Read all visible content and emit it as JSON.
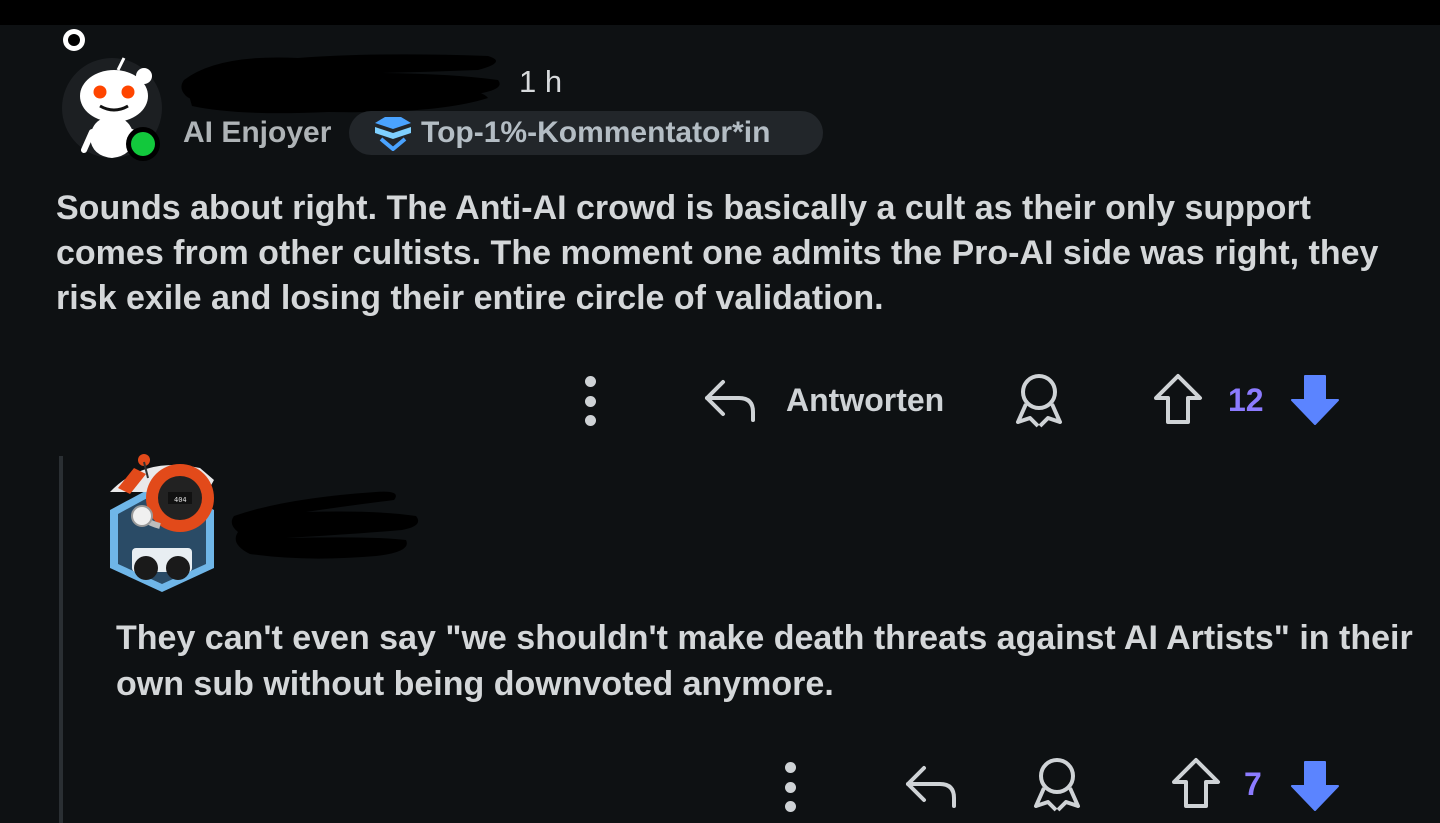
{
  "comment1": {
    "time": "1 h",
    "flair": "AI Enjoyer",
    "badge": "Top-1%-Kommentator*in",
    "text": "Sounds about right. The Anti-AI crowd is basically a cult as their only support comes from other cultists. The moment one admits the Pro-AI side was right, they risk exile and losing their entire circle of validation.",
    "reply_label": "Antworten",
    "score": "12",
    "online": true
  },
  "comment2": {
    "text": "They can't even say \"we shouldn't make death threats against AI Artists\" in their own sub without being downvoted anymore.",
    "score": "7"
  },
  "icons": [
    "more-options-icon",
    "reply-arrow-icon",
    "award-icon",
    "upvote-icon",
    "downvote-filled-icon"
  ],
  "colors": {
    "background": "#0e1113",
    "score": "#8c7bff",
    "downvote": "#5b84ff",
    "online": "#12c83c"
  }
}
